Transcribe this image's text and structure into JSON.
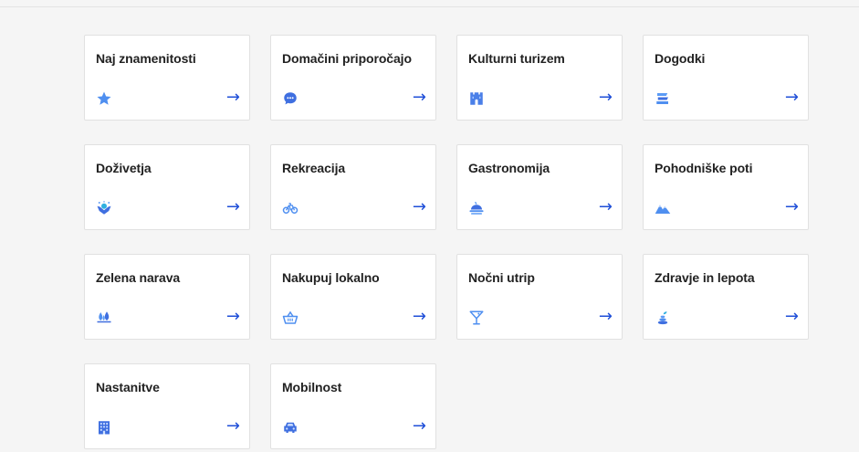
{
  "colors": {
    "accent": "#1f4fd8",
    "icon_light": "#5b9bf5",
    "icon_dark": "#3f6fe0"
  },
  "arrow_glyph": "→",
  "cards": [
    {
      "label": "Naj znamenitosti",
      "icon": "star-icon"
    },
    {
      "label": "Domačini priporočajo",
      "icon": "chat-bubble-icon"
    },
    {
      "label": "Kulturni turizem",
      "icon": "castle-icon"
    },
    {
      "label": "Dogodki",
      "icon": "ticket-stack-icon"
    },
    {
      "label": "Doživetja",
      "icon": "celebration-icon"
    },
    {
      "label": "Rekreacija",
      "icon": "bicycle-icon"
    },
    {
      "label": "Gastronomija",
      "icon": "food-dish-icon"
    },
    {
      "label": "Pohodniške poti",
      "icon": "mountains-icon"
    },
    {
      "label": "Zelena narava",
      "icon": "trees-icon"
    },
    {
      "label": "Nakupuj lokalno",
      "icon": "shopping-basket-icon"
    },
    {
      "label": "Nočni utrip",
      "icon": "cocktail-glass-icon"
    },
    {
      "label": "Zdravje in lepota",
      "icon": "wellness-stones-icon"
    },
    {
      "label": "Nastanitve",
      "icon": "hotel-building-icon"
    },
    {
      "label": "Mobilnost",
      "icon": "car-icon"
    }
  ]
}
